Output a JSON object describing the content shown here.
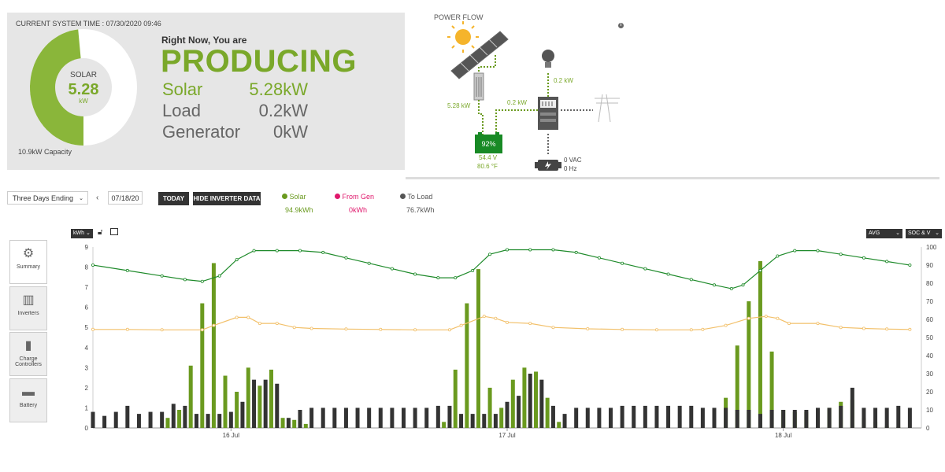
{
  "status": {
    "system_time": "CURRENT SYSTEM TIME : 07/30/2020 09:46",
    "gauge_label": "SOLAR",
    "gauge_value": "5.28",
    "gauge_unit": "kW",
    "gauge_fraction": 0.484,
    "capacity": "10.9kW Capacity",
    "right_now": "Right Now, You are",
    "state": "PRODUCING",
    "rows": [
      {
        "label": "Solar",
        "value": "5.28kW"
      },
      {
        "label": "Load",
        "value": "0.2kW"
      },
      {
        "label": "Generator",
        "value": "0kW"
      }
    ]
  },
  "power_flow": {
    "title": "POWER FLOW",
    "solar_kw": "5.28 kW",
    "load_kw": "0.2 kW",
    "inverter_kw": "0.2 kW",
    "battery_pct": "92%",
    "battery_v": "54.4 V",
    "battery_temp": "80.6 °F",
    "gen_vac": "0 VAC",
    "gen_hz": "0 Hz",
    "info_icon": "info-icon"
  },
  "controls": {
    "range_select": "Three Days Ending",
    "date": "07/18/20",
    "today_btn": "TODAY",
    "hide_btn": "HIDE INVERTER DATA",
    "unit_select": "kWh",
    "avg_select": "AVG",
    "soc_select": "SOC & V"
  },
  "legend": [
    {
      "label": "Solar",
      "value": "94.9kWh",
      "color": "#6a9a1f"
    },
    {
      "label": "From Gen",
      "value": "0kWh",
      "color": "#e0186c"
    },
    {
      "label": "To Load",
      "value": "76.7kWh",
      "color": "#555555"
    }
  ],
  "tabs": [
    {
      "label": "Summary",
      "icon": "gear-icon"
    },
    {
      "label": "Inverters",
      "icon": "inverter-icon"
    },
    {
      "label": "Charge Controllers",
      "icon": "charge-controller-icon"
    },
    {
      "label": "Battery",
      "icon": "battery-icon"
    }
  ],
  "chart_data": {
    "type": "bar",
    "xlabel": "",
    "ylabel": "",
    "x_ticks": [
      "16 Jul",
      "17 Jul",
      "18 Jul"
    ],
    "ylim": [
      0,
      9
    ],
    "ylim_right": [
      0,
      100
    ],
    "y_ticks": [
      0,
      1,
      2,
      3,
      4,
      5,
      6,
      7,
      8,
      9
    ],
    "y_ticks_right": [
      0,
      10,
      20,
      30,
      40,
      50,
      60,
      70,
      80,
      90,
      100
    ],
    "x_range_hours": [
      0,
      72
    ],
    "series": [
      {
        "name": "Solar",
        "kind": "bar",
        "axis": "left",
        "color": "#6a9a1f",
        "points": [
          [
            6.5,
            0.5
          ],
          [
            7.5,
            0.9
          ],
          [
            8.5,
            3.1
          ],
          [
            9.5,
            6.2
          ],
          [
            10.5,
            8.2
          ],
          [
            11.5,
            2.6
          ],
          [
            12.5,
            1.8
          ],
          [
            13.5,
            3.0
          ],
          [
            14.5,
            2.1
          ],
          [
            15.5,
            2.9
          ],
          [
            16.5,
            0.5
          ],
          [
            17.5,
            0.4
          ],
          [
            18.5,
            0.2
          ],
          [
            30.5,
            0.3
          ],
          [
            31.5,
            2.9
          ],
          [
            32.5,
            6.2
          ],
          [
            33.5,
            7.9
          ],
          [
            34.5,
            2.0
          ],
          [
            35.5,
            1.0
          ],
          [
            36.5,
            2.4
          ],
          [
            37.5,
            3.0
          ],
          [
            38.5,
            2.8
          ],
          [
            39.5,
            1.5
          ],
          [
            40.5,
            0.3
          ],
          [
            55.0,
            1.5
          ],
          [
            56.0,
            4.1
          ],
          [
            57.0,
            6.3
          ],
          [
            58.0,
            8.3
          ],
          [
            59.0,
            3.8
          ],
          [
            60.0,
            0.9
          ],
          [
            61.0,
            0.8
          ],
          [
            62.0,
            0.8
          ],
          [
            63.0,
            0.9
          ],
          [
            64.0,
            1.0
          ],
          [
            65.0,
            1.3
          ],
          [
            66.0,
            1.4
          ],
          [
            67.0,
            0.5
          ],
          [
            68.0,
            0.3
          ],
          [
            69.0,
            0.1
          ],
          [
            70.0,
            0.05
          ]
        ]
      },
      {
        "name": "To Load",
        "kind": "bar",
        "axis": "left",
        "color": "#333333",
        "points": [
          [
            0.0,
            0.8
          ],
          [
            1.0,
            0.6
          ],
          [
            2.0,
            0.8
          ],
          [
            3.0,
            1.1
          ],
          [
            4.0,
            0.7
          ],
          [
            5.0,
            0.8
          ],
          [
            6.0,
            0.8
          ],
          [
            7.0,
            1.2
          ],
          [
            8.0,
            1.1
          ],
          [
            9.0,
            0.7
          ],
          [
            10.0,
            0.7
          ],
          [
            11.0,
            0.7
          ],
          [
            12.0,
            0.8
          ],
          [
            13.0,
            1.3
          ],
          [
            14.0,
            2.4
          ],
          [
            15.0,
            2.4
          ],
          [
            16.0,
            2.2
          ],
          [
            17.0,
            0.5
          ],
          [
            18.0,
            0.9
          ],
          [
            19.0,
            1.0
          ],
          [
            20.0,
            1.0
          ],
          [
            21.0,
            1.0
          ],
          [
            22.0,
            1.0
          ],
          [
            23.0,
            1.0
          ],
          [
            24.0,
            1.0
          ],
          [
            25.0,
            1.0
          ],
          [
            26.0,
            1.0
          ],
          [
            27.0,
            1.0
          ],
          [
            28.0,
            1.0
          ],
          [
            29.0,
            1.0
          ],
          [
            30.0,
            1.1
          ],
          [
            31.0,
            1.1
          ],
          [
            32.0,
            0.7
          ],
          [
            33.0,
            0.7
          ],
          [
            34.0,
            0.7
          ],
          [
            35.0,
            0.7
          ],
          [
            36.0,
            1.3
          ],
          [
            37.0,
            1.6
          ],
          [
            38.0,
            2.7
          ],
          [
            39.0,
            2.4
          ],
          [
            40.0,
            1.1
          ],
          [
            41.0,
            0.7
          ],
          [
            42.0,
            1.0
          ],
          [
            43.0,
            1.0
          ],
          [
            44.0,
            1.0
          ],
          [
            45.0,
            1.0
          ],
          [
            46.0,
            1.1
          ],
          [
            47.0,
            1.1
          ],
          [
            48.0,
            1.1
          ],
          [
            49.0,
            1.1
          ],
          [
            50.0,
            1.1
          ],
          [
            51.0,
            1.1
          ],
          [
            52.0,
            1.1
          ],
          [
            53.0,
            1.0
          ],
          [
            54.0,
            1.0
          ],
          [
            55.0,
            1.0
          ],
          [
            56.0,
            0.9
          ],
          [
            57.0,
            0.9
          ],
          [
            58.0,
            0.7
          ],
          [
            59.0,
            0.9
          ],
          [
            60.0,
            0.9
          ],
          [
            61.0,
            0.9
          ],
          [
            62.0,
            0.9
          ],
          [
            63.0,
            1.0
          ],
          [
            64.0,
            1.0
          ],
          [
            65.0,
            1.1
          ],
          [
            66.0,
            2.0
          ],
          [
            67.0,
            1.0
          ],
          [
            68.0,
            1.0
          ],
          [
            69.0,
            1.0
          ],
          [
            70.0,
            1.1
          ],
          [
            71.0,
            1.0
          ]
        ]
      },
      {
        "name": "SOC",
        "kind": "line",
        "axis": "right",
        "color": "#1e8a2a",
        "points": [
          [
            0,
            90
          ],
          [
            3,
            87
          ],
          [
            6,
            84
          ],
          [
            8,
            82
          ],
          [
            9.5,
            81
          ],
          [
            11,
            84
          ],
          [
            12.5,
            93
          ],
          [
            14,
            98
          ],
          [
            16,
            98
          ],
          [
            18,
            98
          ],
          [
            20,
            97
          ],
          [
            22,
            94
          ],
          [
            24,
            91
          ],
          [
            26,
            88
          ],
          [
            28,
            85
          ],
          [
            30,
            83
          ],
          [
            31.5,
            83
          ],
          [
            33,
            87
          ],
          [
            34.5,
            96
          ],
          [
            36,
            98.5
          ],
          [
            38,
            98.5
          ],
          [
            40,
            98.5
          ],
          [
            42,
            97
          ],
          [
            44,
            94
          ],
          [
            46,
            91
          ],
          [
            48,
            88
          ],
          [
            50,
            85
          ],
          [
            52,
            82
          ],
          [
            54,
            79
          ],
          [
            55.5,
            77
          ],
          [
            56.5,
            79
          ],
          [
            58,
            87
          ],
          [
            59.5,
            95
          ],
          [
            61,
            98
          ],
          [
            63,
            98
          ],
          [
            65,
            96
          ],
          [
            67,
            94
          ],
          [
            69,
            92
          ],
          [
            71,
            90
          ]
        ]
      },
      {
        "name": "Voltage",
        "kind": "line",
        "axis": "left",
        "color": "#f2c06a",
        "points": [
          [
            0,
            4.9
          ],
          [
            3,
            4.9
          ],
          [
            6,
            4.88
          ],
          [
            9.5,
            4.88
          ],
          [
            10.5,
            5.1
          ],
          [
            12.5,
            5.5
          ],
          [
            13.5,
            5.5
          ],
          [
            14.5,
            5.2
          ],
          [
            16,
            5.2
          ],
          [
            17.5,
            5.0
          ],
          [
            19,
            4.95
          ],
          [
            22,
            4.92
          ],
          [
            25,
            4.9
          ],
          [
            28,
            4.88
          ],
          [
            31,
            4.88
          ],
          [
            32,
            5.1
          ],
          [
            34,
            5.55
          ],
          [
            35,
            5.45
          ],
          [
            36,
            5.25
          ],
          [
            38,
            5.2
          ],
          [
            40,
            5.0
          ],
          [
            43,
            4.93
          ],
          [
            46,
            4.9
          ],
          [
            49,
            4.88
          ],
          [
            52,
            4.88
          ],
          [
            53,
            4.9
          ],
          [
            55,
            5.1
          ],
          [
            57,
            5.45
          ],
          [
            58.5,
            5.55
          ],
          [
            59.5,
            5.45
          ],
          [
            60.5,
            5.2
          ],
          [
            63,
            5.2
          ],
          [
            65,
            5.0
          ],
          [
            67,
            4.95
          ],
          [
            69,
            4.92
          ],
          [
            71,
            4.9
          ]
        ]
      }
    ]
  }
}
